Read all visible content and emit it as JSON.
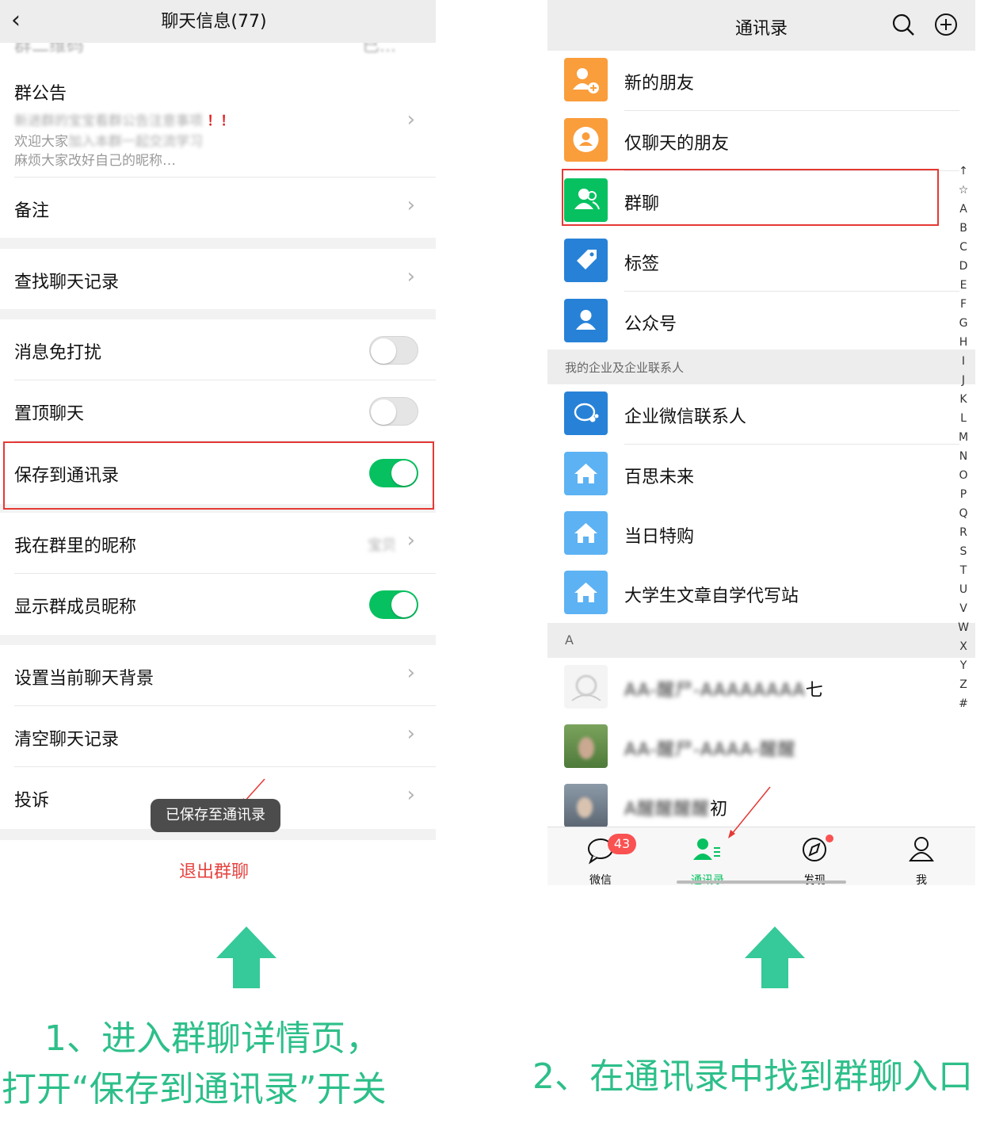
{
  "left_screen": {
    "title": "聊天信息(77)",
    "cut_row_left": "群二维码",
    "cut_row_right": "已...",
    "announcement": {
      "label": "群公告",
      "line1_prefix": "新进群的宝宝看",
      "line1_blur": "群公告注意事项",
      "line1_marks": "！！",
      "line2_prefix": "欢迎大家",
      "line2_blur": "加入本群一起交流学习",
      "line3": "麻烦大家改好自己的昵称…"
    },
    "remark_label": "备注",
    "search_history_label": "查找聊天记录",
    "mute_label": "消息免打扰",
    "pin_label": "置顶聊天",
    "save_contacts_label": "保存到通讯录",
    "my_nickname_label": "我在群里的昵称",
    "my_nickname_value": "宝贝",
    "show_nicknames_label": "显示群成员昵称",
    "background_label": "设置当前聊天背景",
    "clear_history_label": "清空聊天记录",
    "report_label": "投诉",
    "toast": "已保存至通讯录",
    "exit_label": "退出群聊",
    "toggles": {
      "mute": false,
      "pin": false,
      "save_contacts": true,
      "show_nicknames": true
    },
    "chevron": "›"
  },
  "right_screen": {
    "title": "通讯录",
    "items": [
      {
        "label": "新的朋友",
        "icon": "add-friend-icon",
        "color": "#fa9d3b"
      },
      {
        "label": "仅聊天的朋友",
        "icon": "chat-only-friend-icon",
        "color": "#fa9d3b"
      },
      {
        "label": "群聊",
        "icon": "group-chat-icon",
        "color": "#07c160"
      },
      {
        "label": "标签",
        "icon": "tag-icon",
        "color": "#2782d7"
      },
      {
        "label": "公众号",
        "icon": "official-account-icon",
        "color": "#2782d7"
      }
    ],
    "enterprise_section": "我的企业及企业联系人",
    "enterprise_items": [
      {
        "label": "企业微信联系人",
        "icon": "wecom-icon",
        "color": "#2782d7"
      },
      {
        "label": "百思未来",
        "icon": "house-icon",
        "color": "#5cb2f3"
      },
      {
        "label": "当日特购",
        "icon": "house-icon",
        "color": "#5cb2f3"
      },
      {
        "label": "大学生文章自学代写站",
        "icon": "house-icon",
        "color": "#5cb2f3"
      }
    ],
    "section_a": "A",
    "contacts": [
      {
        "blur": "AA-醒尸-AAAAAAAA",
        "suffix": "七"
      },
      {
        "blur": "AA-醒尸-AAAA-醒醒",
        "suffix": ""
      },
      {
        "blur": "A醒醒醒醒",
        "suffix": "初"
      }
    ],
    "index_letters": [
      "↑",
      "☆",
      "A",
      "B",
      "C",
      "D",
      "E",
      "F",
      "G",
      "H",
      "I",
      "J",
      "K",
      "L",
      "M",
      "N",
      "O",
      "P",
      "Q",
      "R",
      "S",
      "T",
      "U",
      "V",
      "W",
      "X",
      "Y",
      "Z",
      "#"
    ],
    "tabs": [
      {
        "label": "微信",
        "icon": "chat-bubble-icon"
      },
      {
        "label": "通讯录",
        "icon": "contacts-icon"
      },
      {
        "label": "发现",
        "icon": "compass-icon"
      },
      {
        "label": "我",
        "icon": "person-icon"
      }
    ],
    "badge": "43"
  },
  "captions": {
    "step1_line1": "1、进入群聊详情页，",
    "step1_line2": "打开“保存到通讯录”开关",
    "step2": "2、在通讯录中找到群聊入口"
  },
  "colors": {
    "green": "#07c160",
    "caption": "#2dbf8a",
    "red": "#e53935"
  }
}
